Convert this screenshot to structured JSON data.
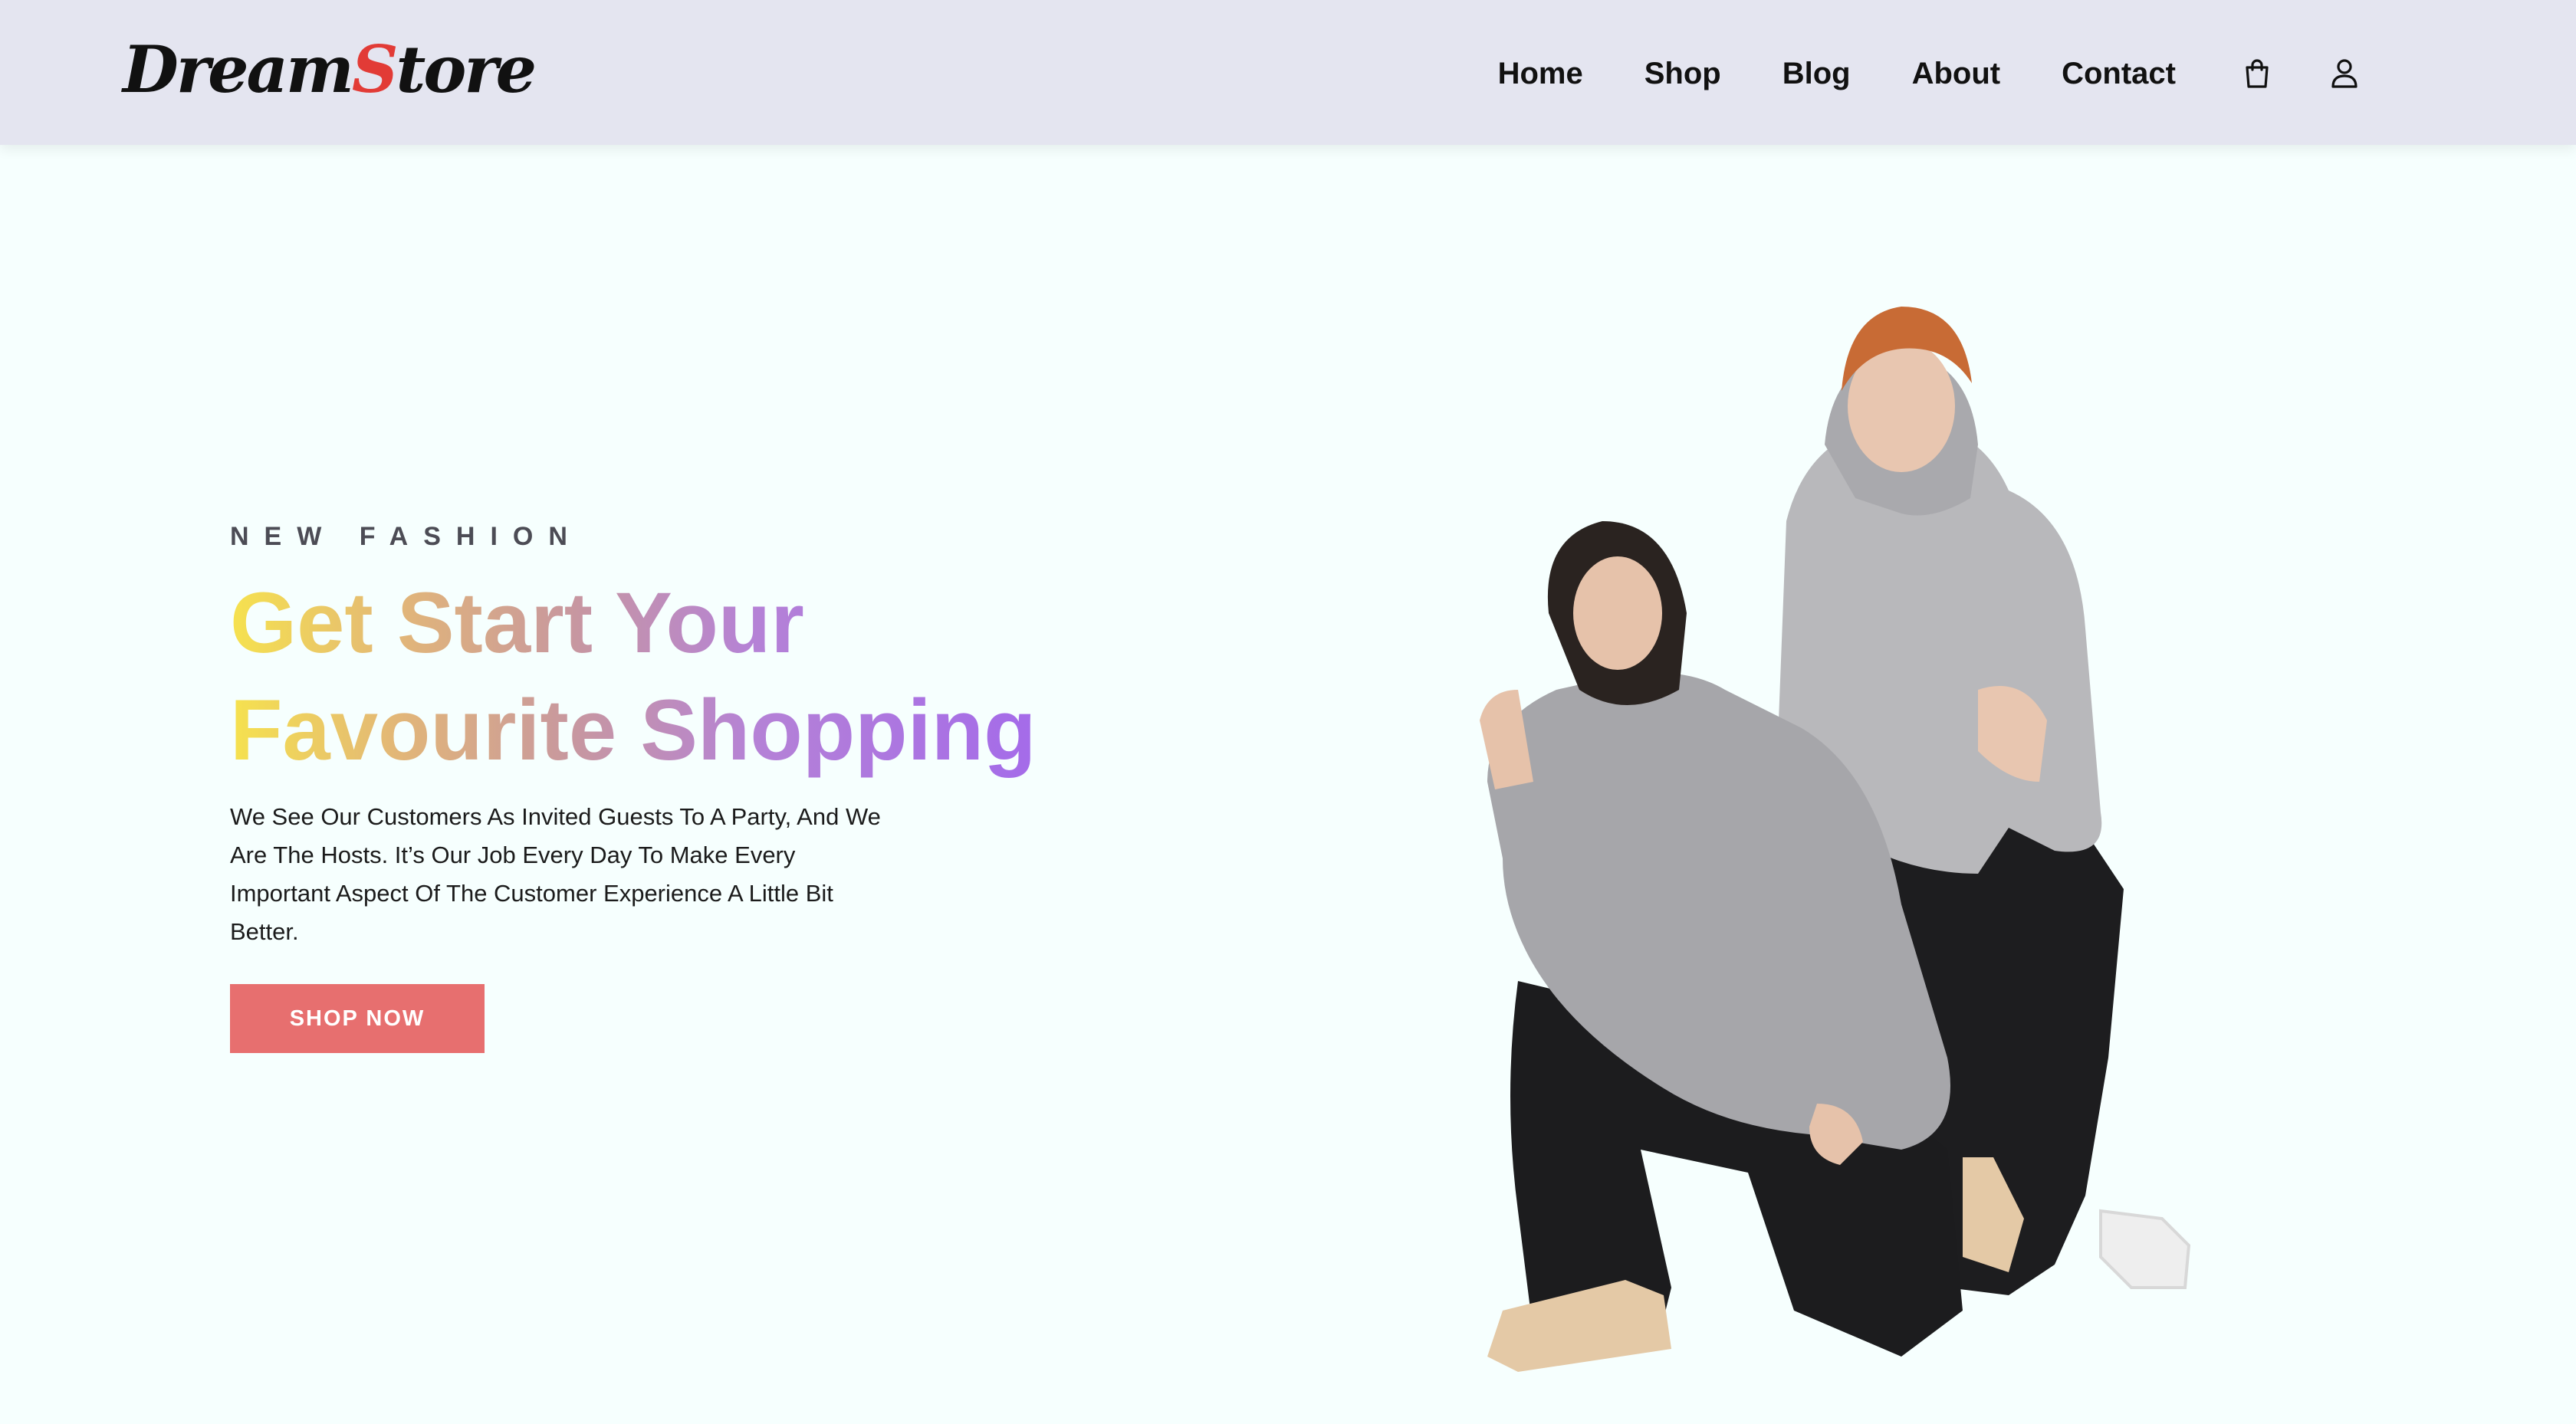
{
  "brand": {
    "logo_main": "Dream",
    "logo_accent": "S",
    "logo_rest": "tore",
    "accent_color": "#e23b36"
  },
  "nav": {
    "links": [
      "Home",
      "Shop",
      "Blog",
      "About",
      "Contact"
    ],
    "icons": [
      "shopping-bag-icon",
      "user-icon"
    ]
  },
  "hero": {
    "eyebrow": "NEW FASHION",
    "headline_line1": "Get Start Your",
    "headline_line2": "Favourite Shopping",
    "description": "We See Our Customers As Invited Guests To A Party, And We Are The Hosts. It’s Our Job Every Day To Make Every Important Aspect Of The Customer Experience A Little Bit Better.",
    "cta_label": "SHOP NOW",
    "cta_color": "#e76f6f",
    "gradient_colors": [
      "#f6e24e",
      "#c8989e",
      "#a268ec"
    ]
  },
  "colors": {
    "nav_bg": "#e4e5f0",
    "page_bg": "#f6fffe"
  }
}
